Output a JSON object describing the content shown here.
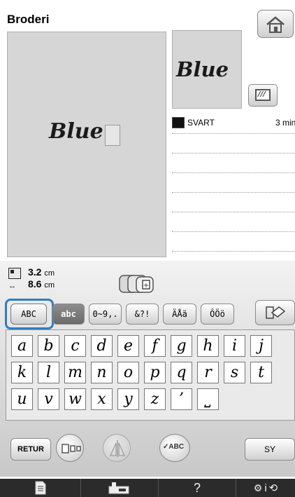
{
  "header": {
    "title": "Broderi",
    "home_icon": "home-icon"
  },
  "preview": {
    "main_text": "Blue",
    "thumbnail_text": "Blue",
    "display_icon": "embroidery-frame-display-icon"
  },
  "colors": [
    {
      "swatch": "#111111",
      "name": "SVART",
      "time": "3 min"
    }
  ],
  "size": {
    "height_value": "3.2",
    "width_value": "8.6",
    "unit": "cm"
  },
  "categories": [
    {
      "label": "ABC",
      "selected": true
    },
    {
      "label": "abc",
      "selected": false
    },
    {
      "label": "0~9,.",
      "selected": false
    },
    {
      "label": "&?!",
      "selected": false
    },
    {
      "label": "ÄÅä",
      "selected": false
    },
    {
      "label": "ÔÖö",
      "selected": false
    }
  ],
  "keyboard": {
    "rows": [
      [
        "a",
        "b",
        "c",
        "d",
        "e",
        "f",
        "g",
        "h",
        "i",
        "j"
      ],
      [
        "k",
        "l",
        "m",
        "n",
        "o",
        "p",
        "q",
        "r",
        "s",
        "t"
      ],
      [
        "u",
        "v",
        "w",
        "x",
        "y",
        "z",
        "’",
        "⎵"
      ]
    ]
  },
  "buttons": {
    "retur": "RETUR",
    "check": "ABC",
    "sy": "SY"
  },
  "bottom_bar": {
    "items": [
      "document-icon",
      "presser-foot-icon",
      "?",
      "settings-info-icon"
    ],
    "help_label": "?",
    "info_label": "i"
  },
  "accent_color": "#2f7dc0"
}
